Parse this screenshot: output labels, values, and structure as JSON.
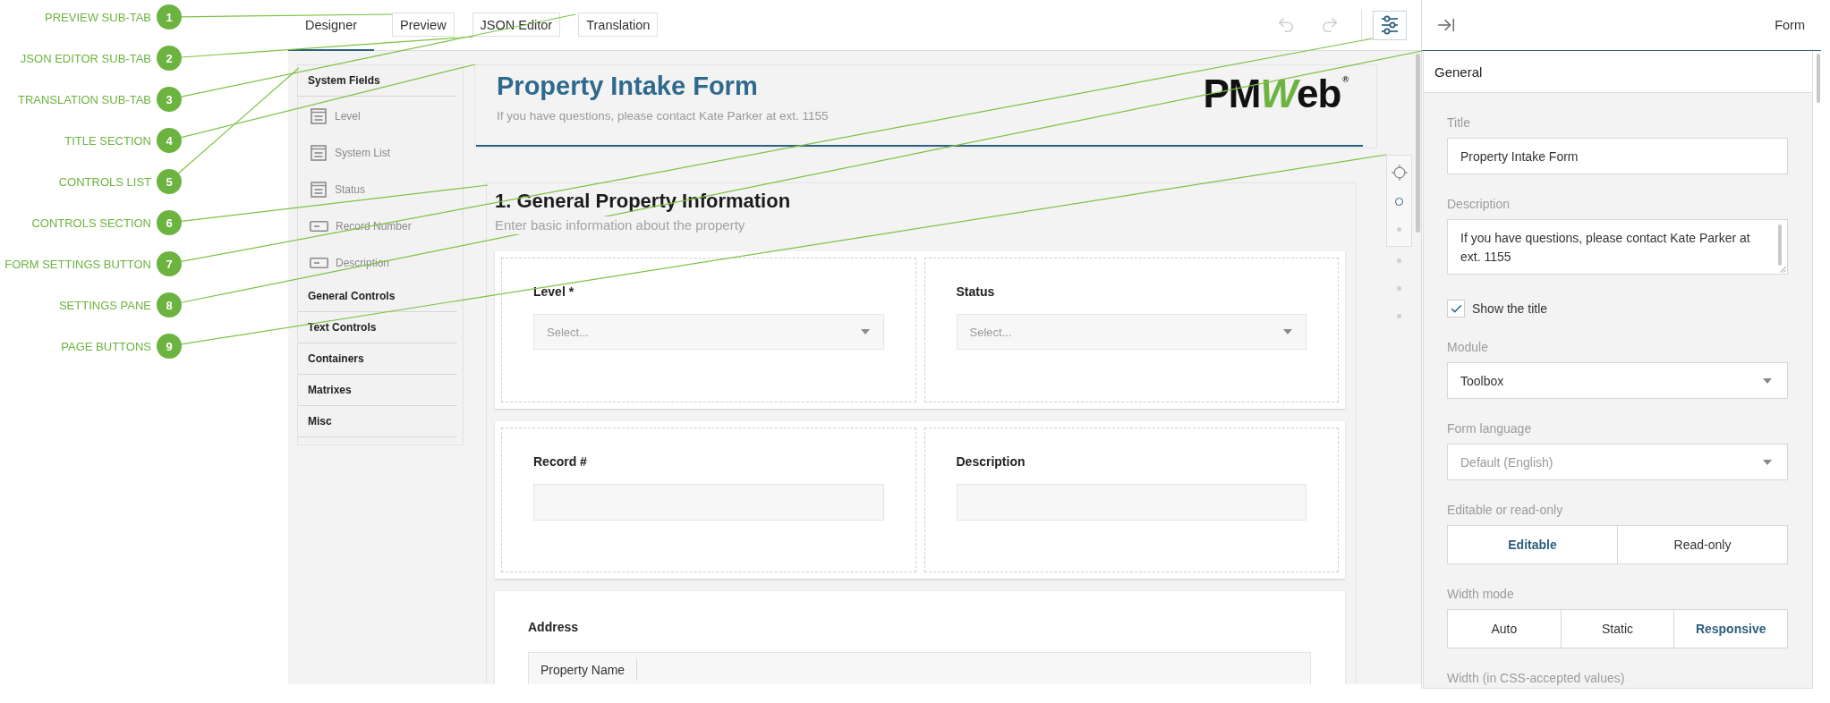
{
  "callouts": [
    {
      "number": "1",
      "label": "PREVIEW SUB-TAB"
    },
    {
      "number": "2",
      "label": "JSON EDITOR SUB-TAB"
    },
    {
      "number": "3",
      "label": "TRANSLATION SUB-TAB"
    },
    {
      "number": "4",
      "label": "TITLE SECTION"
    },
    {
      "number": "5",
      "label": "CONTROLS LIST"
    },
    {
      "number": "6",
      "label": "CONTROLS SECTION"
    },
    {
      "number": "7",
      "label": "FORM SETTINGS BUTTON"
    },
    {
      "number": "8",
      "label": "SETTINGS PANE"
    },
    {
      "number": "9",
      "label": "PAGE BUTTONS"
    }
  ],
  "tabs": [
    {
      "label": "Designer",
      "selected": true
    },
    {
      "label": "Preview",
      "selected": false
    },
    {
      "label": "JSON Editor",
      "selected": false
    },
    {
      "label": "Translation",
      "selected": false
    }
  ],
  "history_buttons": [
    {
      "kind": "undo",
      "disabled": true
    },
    {
      "kind": "redo",
      "disabled": true
    }
  ],
  "settings_toggle": {
    "on": true
  },
  "controls_list": [
    {
      "title": "System Fields",
      "items": [
        {
          "label": "Level",
          "kind": "list"
        },
        {
          "label": "System List",
          "kind": "list"
        },
        {
          "label": "Status",
          "kind": "list"
        },
        {
          "label": "Record Number",
          "kind": "text"
        },
        {
          "label": "Description",
          "kind": "text"
        }
      ]
    },
    {
      "title": "General Controls"
    },
    {
      "title": "Text Controls"
    },
    {
      "title": "Containers"
    },
    {
      "title": "Matrixes"
    },
    {
      "title": "Misc"
    }
  ],
  "form": {
    "title": "Property Intake Form",
    "description": "If you have questions, please contact Kate Parker at ext. 1155",
    "logo": {
      "before": "PM",
      "accent": "W",
      "after": "eb",
      "mark": "®"
    }
  },
  "sections": [
    {
      "title": "1. General Property Information",
      "description": "Enter basic information about the property",
      "rows": [
        {
          "kind": "fields",
          "cells": [
            {
              "label": "Level *",
              "kind": "select",
              "placeholder": "Select..."
            },
            {
              "label": "Status",
              "kind": "select",
              "placeholder": "Select..."
            }
          ]
        },
        {
          "kind": "fields",
          "cells": [
            {
              "label": "Record #",
              "kind": "text"
            },
            {
              "label": "Description",
              "kind": "text"
            }
          ]
        },
        {
          "kind": "table",
          "label": "Address",
          "columns": [
            "Property Name"
          ]
        }
      ]
    }
  ],
  "pages": [
    {
      "selected": true
    },
    {
      "selected": false
    },
    {
      "selected": false
    },
    {
      "selected": false
    },
    {
      "selected": false
    }
  ],
  "settings_pane": {
    "title": "Form",
    "section": "General",
    "fields": [
      {
        "kind": "text",
        "label": "Title",
        "value": "Property Intake Form"
      },
      {
        "kind": "textarea",
        "label": "Description",
        "value": "If you have questions, please contact Kate Parker at ext. 1155"
      },
      {
        "kind": "checkbox",
        "label": "Show the title",
        "checked": true
      },
      {
        "kind": "select",
        "label": "Module",
        "value": "Toolbox"
      },
      {
        "kind": "select",
        "label": "Form language",
        "placeholder": "Default (English)"
      },
      {
        "kind": "segmented",
        "label": "Editable or read-only",
        "options": [
          {
            "label": "Editable",
            "selected": true
          },
          {
            "label": "Read-only",
            "selected": false
          }
        ]
      },
      {
        "kind": "segmented",
        "label": "Width mode",
        "options": [
          {
            "label": "Auto",
            "selected": false
          },
          {
            "label": "Static",
            "selected": false
          },
          {
            "label": "Responsive",
            "selected": true
          }
        ]
      },
      {
        "kind": "caption",
        "label": "Width (in CSS-accepted values)"
      }
    ]
  }
}
